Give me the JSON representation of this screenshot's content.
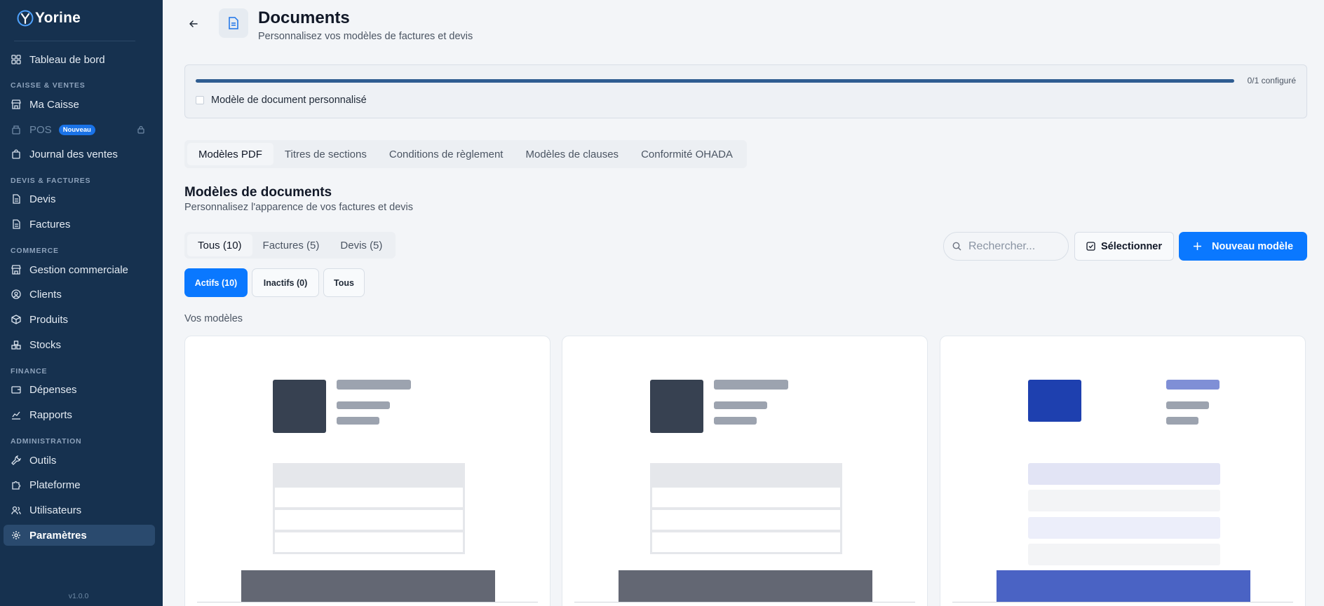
{
  "app": {
    "name": "Yorine",
    "version": "v1.0.0"
  },
  "sidebar": {
    "dashboard": "Tableau de bord",
    "sections": {
      "sales": "CAISSE & VENTES",
      "quotes": "DEVIS & FACTURES",
      "commerce": "COMMERCE",
      "finance": "FINANCE",
      "admin": "ADMINISTRATION"
    },
    "items": {
      "caisse": "Ma Caisse",
      "pos": "POS",
      "pos_badge": "Nouveau",
      "journal": "Journal des ventes",
      "devis": "Devis",
      "factures": "Factures",
      "gestion": "Gestion commerciale",
      "clients": "Clients",
      "produits": "Produits",
      "stocks": "Stocks",
      "depenses": "Dépenses",
      "rapports": "Rapports",
      "outils": "Outils",
      "plateforme": "Plateforme",
      "utilisateurs": "Utilisateurs",
      "parametres": "Paramètres"
    }
  },
  "header": {
    "title": "Documents",
    "subtitle": "Personnalisez vos modèles de factures et devis"
  },
  "progress": {
    "text": "0/1 configuré",
    "fraction": 1.0,
    "item_label": "Modèle de document personnalisé"
  },
  "tabs": [
    "Modèles PDF",
    "Titres de sections",
    "Conditions de règlement",
    "Modèles de clauses",
    "Conformité OHADA"
  ],
  "section": {
    "title": "Modèles de documents",
    "subtitle": "Personnalisez l'apparence de vos factures et devis"
  },
  "filters": {
    "types": [
      "Tous (10)",
      "Factures (5)",
      "Devis (5)"
    ],
    "status": [
      "Actifs (10)",
      "Inactifs (0)",
      "Tous"
    ]
  },
  "search": {
    "placeholder": "Rechercher..."
  },
  "buttons": {
    "select": "Sélectionner",
    "new_model": "Nouveau modèle"
  },
  "list_title": "Vos modèles",
  "colors": {
    "sidebar_bg": "#16314f",
    "accent": "#0a78ff",
    "progress": "#2f5d91",
    "template_dark": "#374151",
    "template_blue": "#1e40af"
  }
}
